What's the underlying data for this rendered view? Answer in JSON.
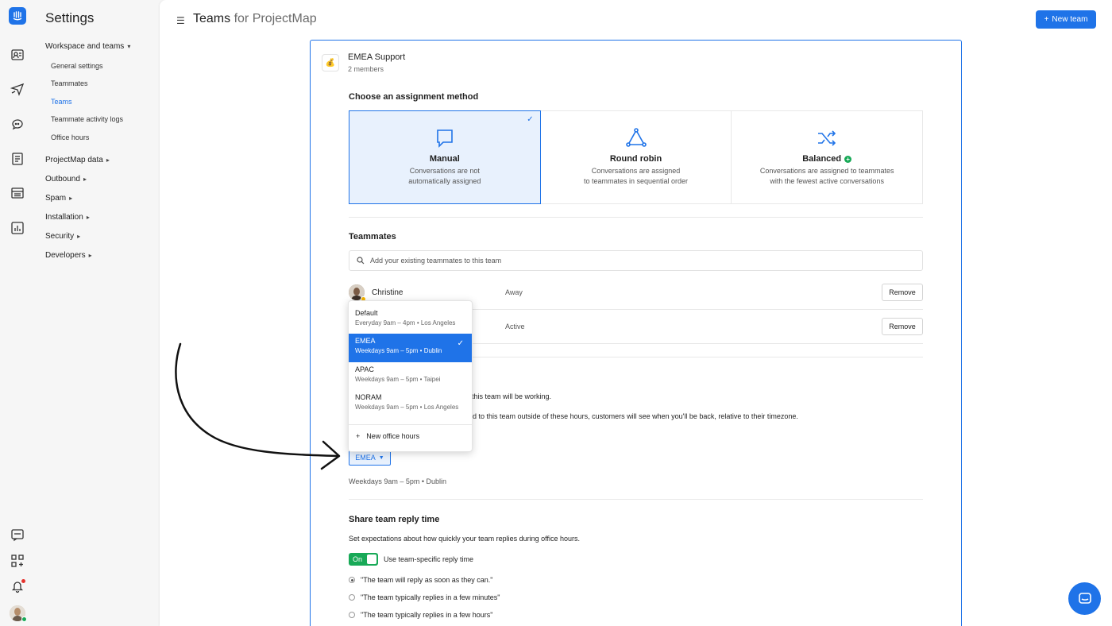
{
  "sidebar": {
    "title": "Settings",
    "groups": [
      {
        "label": "Workspace and teams",
        "expanded": true
      },
      {
        "label": "ProjectMap data"
      },
      {
        "label": "Outbound"
      },
      {
        "label": "Spam"
      },
      {
        "label": "Installation"
      },
      {
        "label": "Security"
      },
      {
        "label": "Developers"
      }
    ],
    "items": [
      {
        "label": "General settings"
      },
      {
        "label": "Teammates"
      },
      {
        "label": "Teams",
        "active": true
      },
      {
        "label": "Teammate activity logs"
      },
      {
        "label": "Office hours"
      }
    ]
  },
  "header": {
    "title": "Teams",
    "title_suffix": "for ProjectMap",
    "new_team_label": "New team"
  },
  "team": {
    "icon": "money-bag-icon",
    "name": "EMEA Support",
    "members": "2 members"
  },
  "assignment": {
    "title": "Choose an assignment method",
    "methods": [
      {
        "name": "Manual",
        "desc_line1": "Conversations are not",
        "desc_line2": "automatically assigned",
        "selected": true
      },
      {
        "name": "Round robin",
        "desc_line1": "Conversations are assigned",
        "desc_line2": "to teammates in sequential order"
      },
      {
        "name": "Balanced",
        "desc_line1": "Conversations are assigned to teammates",
        "desc_line2": "with the fewest active conversations"
      }
    ]
  },
  "teammates": {
    "title": "Teammates",
    "search_placeholder": "Add your existing teammates to this team",
    "rows": [
      {
        "name": "Christine",
        "status": "Away",
        "action": "Remove"
      },
      {
        "name": "",
        "status": "Active",
        "action": "Remove"
      }
    ]
  },
  "office_hours": {
    "text1_visible": "this team will be working.",
    "text2_visible": "d to this team outside of these hours, customers will see when you'll be back, relative to their timezone.",
    "selected": "EMEA",
    "selected_schedule": "Weekdays 9am – 5pm • Dublin",
    "options": [
      {
        "name": "Default",
        "schedule": "Everyday 9am – 4pm • Los Angeles"
      },
      {
        "name": "EMEA",
        "schedule": "Weekdays 9am – 5pm • Dublin",
        "selected": true
      },
      {
        "name": "APAC",
        "schedule": "Weekdays 9am – 5pm • Taipei"
      },
      {
        "name": "NORAM",
        "schedule": "Weekdays 9am – 5pm • Los Angeles"
      }
    ],
    "new_label": "New office hours"
  },
  "reply_time": {
    "title": "Share team reply time",
    "desc": "Set expectations about how quickly your team replies during office hours.",
    "toggle_label": "On",
    "toggle_text": "Use team-specific reply time",
    "options": [
      {
        "label": "\"The team will reply as soon as they can.\"",
        "checked": true
      },
      {
        "label": "\"The team typically replies in a few minutes\""
      },
      {
        "label": "\"The team typically replies in a few hours\""
      }
    ]
  },
  "colors": {
    "accent": "#1f73e8",
    "success": "#18a957"
  }
}
